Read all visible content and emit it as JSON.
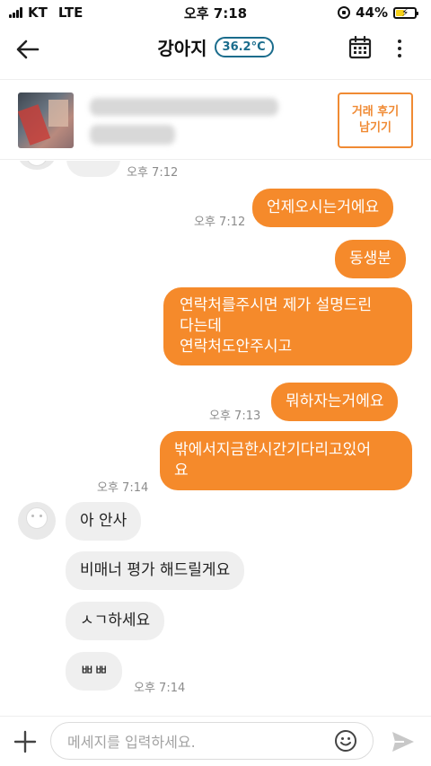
{
  "status": {
    "carrier": "KT",
    "network": "LTE",
    "time": "오후 7:18",
    "battery": "44%",
    "battery_level": 0.44
  },
  "header": {
    "title": "강아지",
    "temperature": "36.2°C"
  },
  "product": {
    "review_line1": "거래 후기",
    "review_line2": "남기기"
  },
  "chat": {
    "messages": [
      {
        "sender": "other",
        "text": "",
        "time": "오후 7:12"
      },
      {
        "sender": "me",
        "text": "언제오시는거에요",
        "time": "오후 7:12"
      },
      {
        "sender": "me",
        "text": "동생분"
      },
      {
        "sender": "me",
        "text": "연락처를주시면 제가 설명드린\n다는데\n연락처도안주시고"
      },
      {
        "sender": "me",
        "text": "뭐하자는거에요",
        "time": "오후 7:13"
      },
      {
        "sender": "me",
        "text": "밖에서지금한시간기다리고있어\n요",
        "time": "오후 7:14"
      },
      {
        "sender": "other",
        "text": "아 안사"
      },
      {
        "sender": "other",
        "text": "비매너 평가 해드릴게요"
      },
      {
        "sender": "other",
        "text": "ㅅㄱ하세요"
      },
      {
        "sender": "other",
        "text": "ㅃㅃ",
        "time": "오후 7:14"
      }
    ]
  },
  "input": {
    "placeholder": "메세지를 입력하세요."
  },
  "colors": {
    "accent": "#f58a2b",
    "badge": "#1a6c8c",
    "other_bubble": "#efefef"
  },
  "icons": [
    "back-arrow-icon",
    "calendar-icon",
    "more-vertical-icon",
    "plus-icon",
    "emoji-icon",
    "send-icon"
  ]
}
